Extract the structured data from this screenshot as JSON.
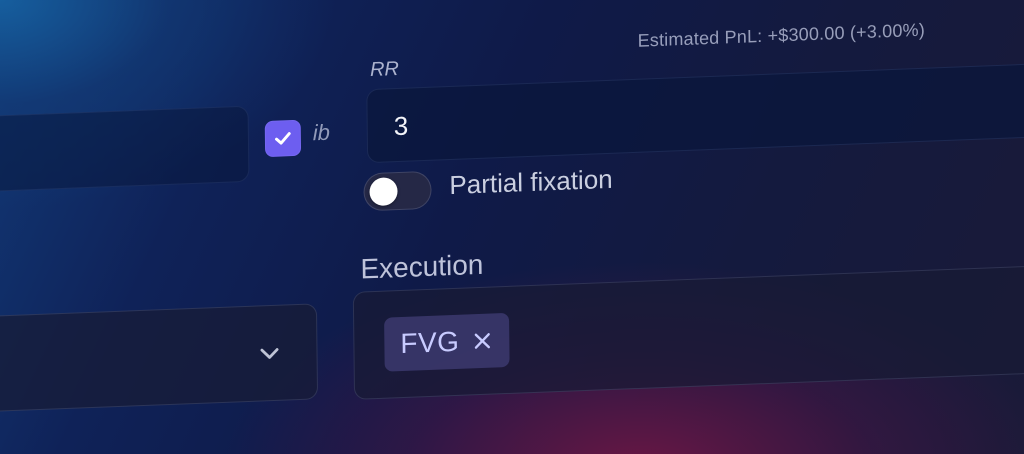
{
  "checkbox": {
    "label": "ib",
    "checked": true,
    "color": "#6d5ef0",
    "icon": "checkmark-icon"
  },
  "pnl": {
    "text": "Estimated PnL: +$300.00 (+3.00%)"
  },
  "rr": {
    "label": "RR",
    "value": "3"
  },
  "partial_fixation": {
    "label": "Partial fixation",
    "enabled": false
  },
  "execution": {
    "label": "Execution",
    "chips": [
      {
        "label": "FVG",
        "remove_icon": "close-icon"
      }
    ]
  },
  "select": {
    "icon": "chevron-down-icon"
  }
}
